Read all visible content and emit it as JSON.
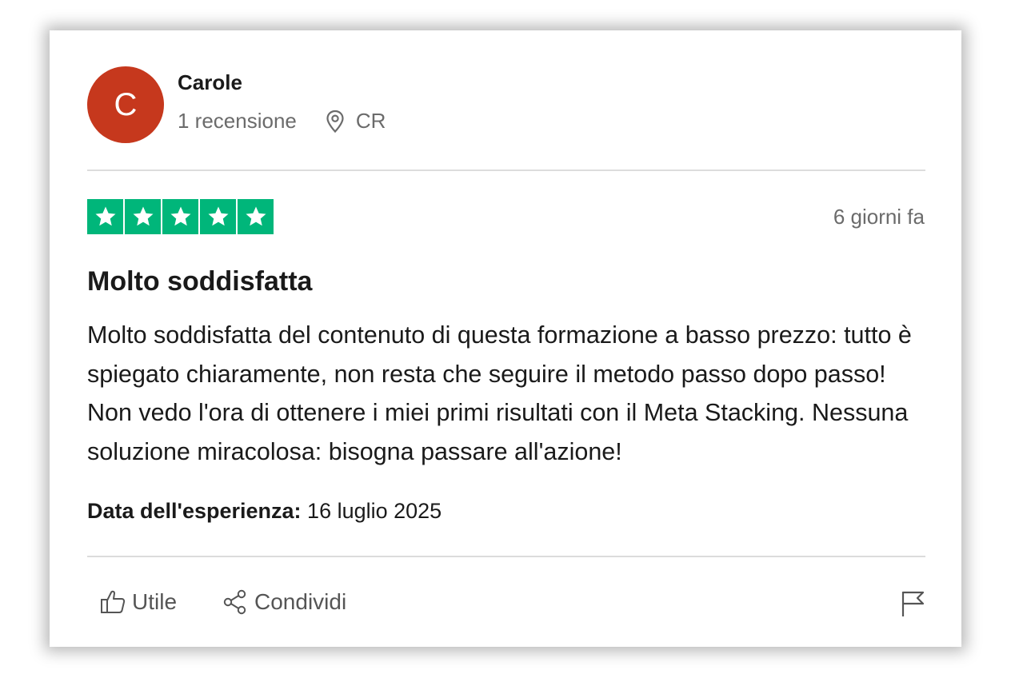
{
  "colors": {
    "avatar_bg": "#c6381d",
    "star_bg": "#00b67a",
    "muted_text": "#6b6b6b",
    "icon": "#555555"
  },
  "reviewer": {
    "initial": "C",
    "name": "Carole",
    "review_count": "1 recensione",
    "location": "CR",
    "location_icon": "location-pin-icon"
  },
  "review": {
    "rating": 5,
    "rating_max": 5,
    "posted_ago": "6 giorni fa",
    "title": "Molto soddisfatta",
    "body": "Molto soddisfatta del contenuto di questa formazione a basso prezzo: tutto è spiegato chiaramente, non resta che seguire il metodo passo dopo passo! Non vedo l'ora di ottenere i miei primi risultati con il Meta Stacking. Nessuna soluzione miracolosa: bisogna passare all'azione!",
    "experience_label": "Data dell'esperienza:",
    "experience_date": "16 luglio 2025"
  },
  "actions": {
    "useful_label": "Utile",
    "useful_icon": "thumbs-up-icon",
    "share_label": "Condividi",
    "share_icon": "share-icon",
    "report_icon": "flag-icon"
  }
}
